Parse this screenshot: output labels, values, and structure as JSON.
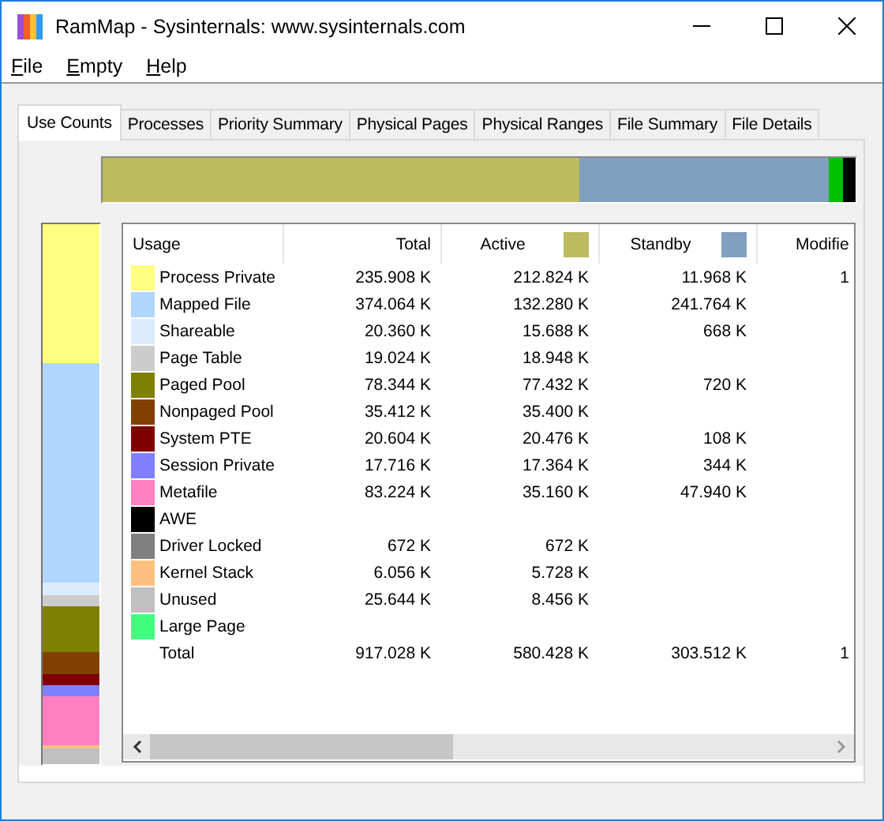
{
  "window": {
    "title": "RamMap - Sysinternals: www.sysinternals.com"
  },
  "menu": [
    {
      "label": "File"
    },
    {
      "label": "Empty"
    },
    {
      "label": "Help"
    }
  ],
  "tabs": [
    {
      "label": "Use Counts",
      "selected": true
    },
    {
      "label": "Processes",
      "selected": false
    },
    {
      "label": "Priority Summary",
      "selected": false
    },
    {
      "label": "Physical Pages",
      "selected": false
    },
    {
      "label": "Physical Ranges",
      "selected": false
    },
    {
      "label": "File Summary",
      "selected": false
    },
    {
      "label": "File Details",
      "selected": false
    }
  ],
  "table": {
    "columns": [
      {
        "label": "Usage"
      },
      {
        "label": "Total"
      },
      {
        "label": "Active",
        "color": "#bdbb5f"
      },
      {
        "label": "Standby",
        "color": "#819fbf"
      },
      {
        "label": "Modifie"
      }
    ],
    "rows": [
      {
        "usage": "Process Private",
        "color": "#ffff80",
        "total": "235.908 K",
        "active": "212.824 K",
        "standby": "11.968 K",
        "modified": "1"
      },
      {
        "usage": "Mapped File",
        "color": "#b0d6ff",
        "total": "374.064 K",
        "active": "132.280 K",
        "standby": "241.764 K"
      },
      {
        "usage": "Shareable",
        "color": "#dcecff",
        "total": "20.360 K",
        "active": "15.688 K",
        "standby": "668 K"
      },
      {
        "usage": "Page Table",
        "color": "#cccccc",
        "total": "19.024 K",
        "active": "18.948 K"
      },
      {
        "usage": "Paged Pool",
        "color": "#808000",
        "total": "78.344 K",
        "active": "77.432 K",
        "standby": "720 K"
      },
      {
        "usage": "Nonpaged Pool",
        "color": "#804000",
        "total": "35.412 K",
        "active": "35.400 K"
      },
      {
        "usage": "System PTE",
        "color": "#800000",
        "total": "20.604 K",
        "active": "20.476 K",
        "standby": "108 K"
      },
      {
        "usage": "Session Private",
        "color": "#8080ff",
        "total": "17.716 K",
        "active": "17.364 K",
        "standby": "344 K"
      },
      {
        "usage": "Metafile",
        "color": "#ff80c0",
        "total": "83.224 K",
        "active": "35.160 K",
        "standby": "47.940 K"
      },
      {
        "usage": "AWE",
        "color": "#000000"
      },
      {
        "usage": "Driver Locked",
        "color": "#808080",
        "total": "672 K",
        "active": "672 K"
      },
      {
        "usage": "Kernel Stack",
        "color": "#ffc080",
        "total": "6.056 K",
        "active": "5.728 K"
      },
      {
        "usage": "Unused",
        "color": "#c0c0c0",
        "total": "25.644 K",
        "active": "8.456 K"
      },
      {
        "usage": "Large Page",
        "color": "#40ff80"
      },
      {
        "usage": "Total",
        "total": "917.028 K",
        "active": "580.428 K",
        "standby": "303.512 K",
        "modified": "1"
      }
    ]
  }
}
